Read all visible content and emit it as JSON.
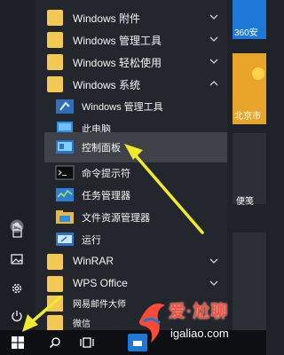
{
  "start_menu": {
    "apps": [
      {
        "label": "Windows 附件",
        "icon": "folder-icon",
        "chevron": "down"
      },
      {
        "label": "Windows 管理工具",
        "icon": "folder-icon",
        "chevron": "down"
      },
      {
        "label": "Windows 轻松使用",
        "icon": "folder-icon",
        "chevron": "down"
      },
      {
        "label": "Windows 系统",
        "icon": "folder-icon",
        "chevron": "up"
      },
      {
        "label": "Windows 管理工具",
        "icon": "admin-tools-icon"
      },
      {
        "label": "此电脑",
        "icon": "computer-icon"
      },
      {
        "label": "控制面板",
        "icon": "control-panel-icon",
        "highlighted": true
      },
      {
        "label": "命令提示符",
        "icon": "cmd-icon"
      },
      {
        "label": "任务管理器",
        "icon": "task-manager-icon"
      },
      {
        "label": "文件资源管理器",
        "icon": "file-explorer-icon"
      },
      {
        "label": "运行",
        "icon": "run-icon"
      },
      {
        "label": "WinRAR",
        "icon": "folder-icon",
        "chevron": "down"
      },
      {
        "label": "WPS Office",
        "icon": "folder-icon",
        "chevron": "down"
      },
      {
        "label": "网易邮件大师",
        "icon": "mail-icon"
      },
      {
        "label": "微信",
        "icon": "folder-icon"
      }
    ]
  },
  "tiles": {
    "t1": "360安",
    "t2": "北京市",
    "t3": "便笺"
  },
  "watermark": {
    "text": "爱·尬聊",
    "domain": "igaliao.com"
  },
  "colors": {
    "accent": "#1e78d8",
    "arrow": "#f0ea2a",
    "folder": "#f2c953",
    "highlight": "#3f4349"
  }
}
